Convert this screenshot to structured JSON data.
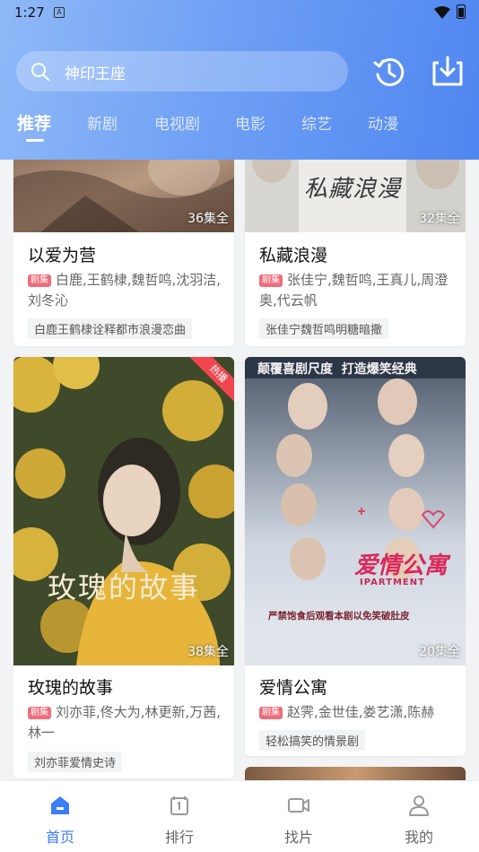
{
  "status": {
    "time": "1:27",
    "notif": "A"
  },
  "search": {
    "text": "神印王座"
  },
  "tabs": [
    "推荐",
    "新剧",
    "电视剧",
    "电影",
    "综艺",
    "动漫"
  ],
  "cards": [
    {
      "title": "以爱为营",
      "episodes": "36集全",
      "badge": "剧集",
      "cast": "白鹿,王鹤棣,魏哲鸣,沈羽洁,刘冬沁",
      "tag": "白鹿王鹤棣诠释都市浪漫恋曲",
      "poster_title": ""
    },
    {
      "title": "私藏浪漫",
      "episodes": "32集全",
      "badge": "剧集",
      "cast": "张佳宁,魏哲鸣,王真儿,周澄奥,代云帆",
      "tag": "张佳宁魏哲鸣明糖暗撒",
      "poster_title": "私藏浪漫"
    },
    {
      "title": "玫瑰的故事",
      "episodes": "38集全",
      "badge": "剧集",
      "cast": "刘亦菲,佟大为,林更新,万茜,林一",
      "tag": "刘亦菲爱情史诗",
      "poster_title": "玫瑰的故事",
      "ribbon": "热播"
    },
    {
      "title": "爱情公寓",
      "episodes": "20集全",
      "badge": "剧集",
      "cast": "赵霁,金世佳,娄艺潇,陈赫",
      "tag": "轻松搞笑的情景剧",
      "poster_title": "爱情公寓",
      "poster_top": "颠覆喜剧尺度  打造爆笑经典",
      "poster_sub": "IPARTMENT",
      "poster_bottom": "严禁饱食后观看本剧以免笑破肚皮"
    }
  ],
  "nav": [
    {
      "label": "首页",
      "icon": "home-icon",
      "active": true
    },
    {
      "label": "排行",
      "icon": "ranking-icon",
      "active": false
    },
    {
      "label": "找片",
      "icon": "video-icon",
      "active": false
    },
    {
      "label": "我的",
      "icon": "profile-icon",
      "active": false
    }
  ],
  "colors": {
    "accent": "#3d7ef5",
    "badge": "#f06b7a",
    "ribbon": "#f0464e"
  }
}
